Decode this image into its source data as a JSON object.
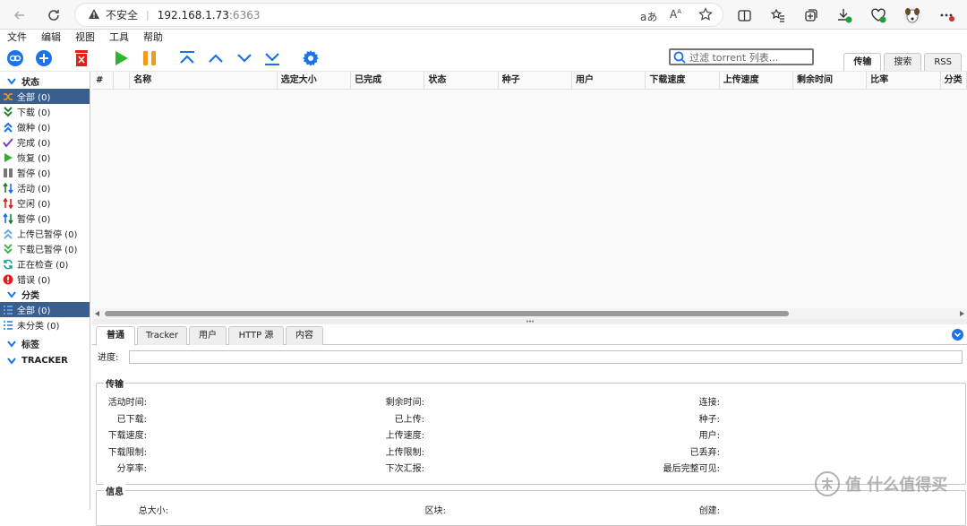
{
  "browser": {
    "insecure": "不安全",
    "host": "192.168.1.73",
    "port": ":6363"
  },
  "menu": [
    "文件",
    "编辑",
    "视图",
    "工具",
    "帮助"
  ],
  "filter": {
    "placeholder": "过滤 torrent 列表..."
  },
  "top_tabs": [
    "传输",
    "搜索",
    "RSS"
  ],
  "sidebar": {
    "status_header": "状态",
    "status": [
      "全部 (0)",
      "下载 (0)",
      "做种 (0)",
      "完成 (0)",
      "恢复 (0)",
      "暂停 (0)",
      "活动 (0)",
      "空闲 (0)",
      "暂停 (0)",
      "上传已暂停 (0)",
      "下载已暂停 (0)",
      "正在检查 (0)",
      "错误 (0)"
    ],
    "cat_header": "分类",
    "categories": [
      "全部 (0)",
      "未分类 (0)"
    ],
    "tags_header": "标签",
    "tracker_header": "TRACKER"
  },
  "columns": [
    "#",
    "",
    "名称",
    "选定大小",
    "已完成",
    "状态",
    "种子",
    "用户",
    "下载速度",
    "上传速度",
    "剩余时间",
    "比率",
    "分类"
  ],
  "detail_tabs": [
    "普通",
    "Tracker",
    "用户",
    "HTTP 源",
    "内容"
  ],
  "progress_label": "进度:",
  "transfer": {
    "legend": "传输",
    "col1": [
      "活动时间:",
      "已下载:",
      "下载速度:",
      "下载限制:",
      "分享率:"
    ],
    "col2": [
      "剩余时间:",
      "已上传:",
      "上传速度:",
      "上传限制:",
      "下次汇报:"
    ],
    "col3": [
      "连接:",
      "种子:",
      "用户:",
      "已丢弃:",
      "最后完整可见:"
    ]
  },
  "info": {
    "legend": "信息",
    "cut": [
      "总大小:",
      "区块:",
      "创建:"
    ]
  },
  "watermark": "值 什么值得买",
  "colors": {
    "selected": "#3a5f8f",
    "accent": "#1a73e8",
    "play": "#2db52d",
    "pause": "#f29a1b",
    "delete": "#e02020"
  }
}
